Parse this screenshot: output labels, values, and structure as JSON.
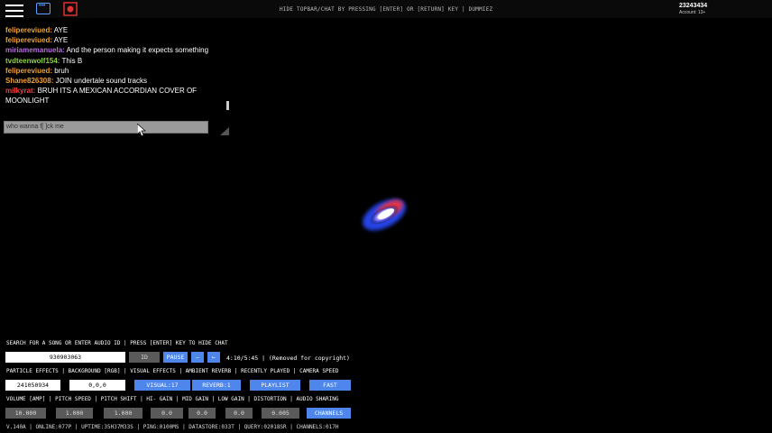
{
  "topbar": {
    "hint": "HIDE TOPBAR/CHAT BY PRESSING [ENTER] OR [RETURN] KEY | DUMMIEZ",
    "account_name": "23243434",
    "account_sub": "Account: 13+"
  },
  "chat": {
    "messages": [
      {
        "name": "felipereviued:",
        "text": "AYE",
        "color": "#f0a030"
      },
      {
        "name": "felipereviued:",
        "text": "AYE",
        "color": "#f0a030"
      },
      {
        "name": "miriamemanuela:",
        "text": "And the person making it expects something",
        "color": "#b86ee0"
      },
      {
        "name": "tvdteenwolf154:",
        "text": "This B",
        "color": "#8ecf4a"
      },
      {
        "name": "felipereviued:",
        "text": "bruh",
        "color": "#f0a030"
      },
      {
        "name": "Shane826308:",
        "text": "JOIN undertale sound tracks",
        "color": "#f0a030"
      },
      {
        "name": "milkyrat:",
        "text": "BRUH ITS A MEXICAN ACCORDIAN COVER OF MOONLIGHT",
        "color": "#f04040"
      }
    ],
    "input_value": "who wanna f[ ]ck me"
  },
  "panel": {
    "search_label": "SEARCH FOR A SONG OR ENTER AUDIO ID | PRESS [ENTER] KEY TO HIDE CHAT",
    "audio_id": "930903063",
    "id_btn": "ID",
    "pause_btn": "PAUSE",
    "minus_btn": "—",
    "back_btn": "←",
    "time_text": "4:10/5:45 | (Removed for copyright)",
    "row2_label": "PARTICLE EFFECTS | BACKGROUND [RGB] | VISUAL EFFECTS | AMBIENT REVERB | RECENTLY PLAYED | CAMERA SPEED",
    "particle": "241050934",
    "background": "0,0,0",
    "visual_btn": "VISUAL:17",
    "reverb_btn": "REVERB:1",
    "playlist_btn": "PLAYLIST",
    "fast_btn": "FAST",
    "row3_label": "VOLUME [AMP] | PITCH SPEED | PITCH SHIFT | HI- GAIN | MID GAIN | LOW GAIN | DISTORTION | AUDIO SHARING",
    "volume": "10.000",
    "pitch_speed": "1.000",
    "pitch_shift": "1.000",
    "hi_gain": "0.0",
    "mid_gain": "0.0",
    "low_gain": "0.0",
    "distortion": "0.005",
    "channels_btn": "CHANNELS",
    "status": "V.140A | ONLINE:077P | UPTIME:35H37M33S | PING:0100MS | DATASTORE:033T | QUERY:02018SR | CHANNELS:017H"
  }
}
